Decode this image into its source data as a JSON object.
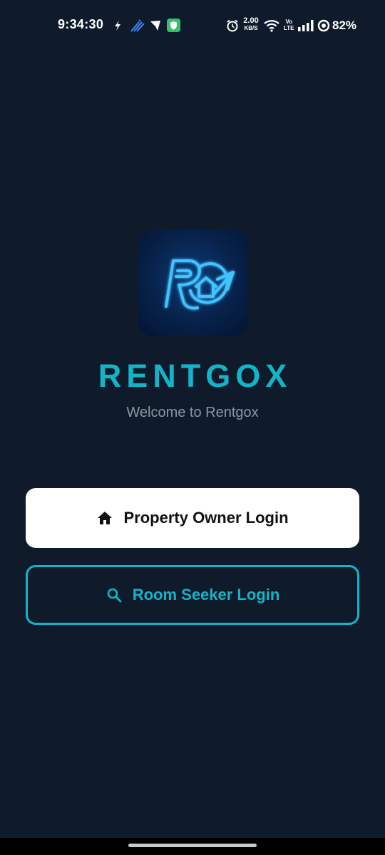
{
  "status_bar": {
    "time": "9:34:30",
    "network_speed_value": "2.00",
    "network_speed_unit": "KB/S",
    "volte_top": "Vo",
    "volte_bottom": "LTE",
    "battery": "82%",
    "icons": [
      "flash-icon",
      "stripes-icon",
      "send-icon",
      "shield-icon",
      "alarm-icon",
      "wifi-icon",
      "signal-icon",
      "battery-ring-icon"
    ]
  },
  "app": {
    "title": "RENTGOX",
    "subtitle": "Welcome to Rentgox"
  },
  "buttons": {
    "owner_label": "Property Owner Login",
    "owner_icon": "home-icon",
    "seeker_label": "Room Seeker Login",
    "seeker_icon": "search-icon"
  },
  "colors": {
    "background": "#0f1b2b",
    "accent": "#14b3c8",
    "subtitle": "#8d96a3",
    "primary_button": "#ffffff"
  }
}
